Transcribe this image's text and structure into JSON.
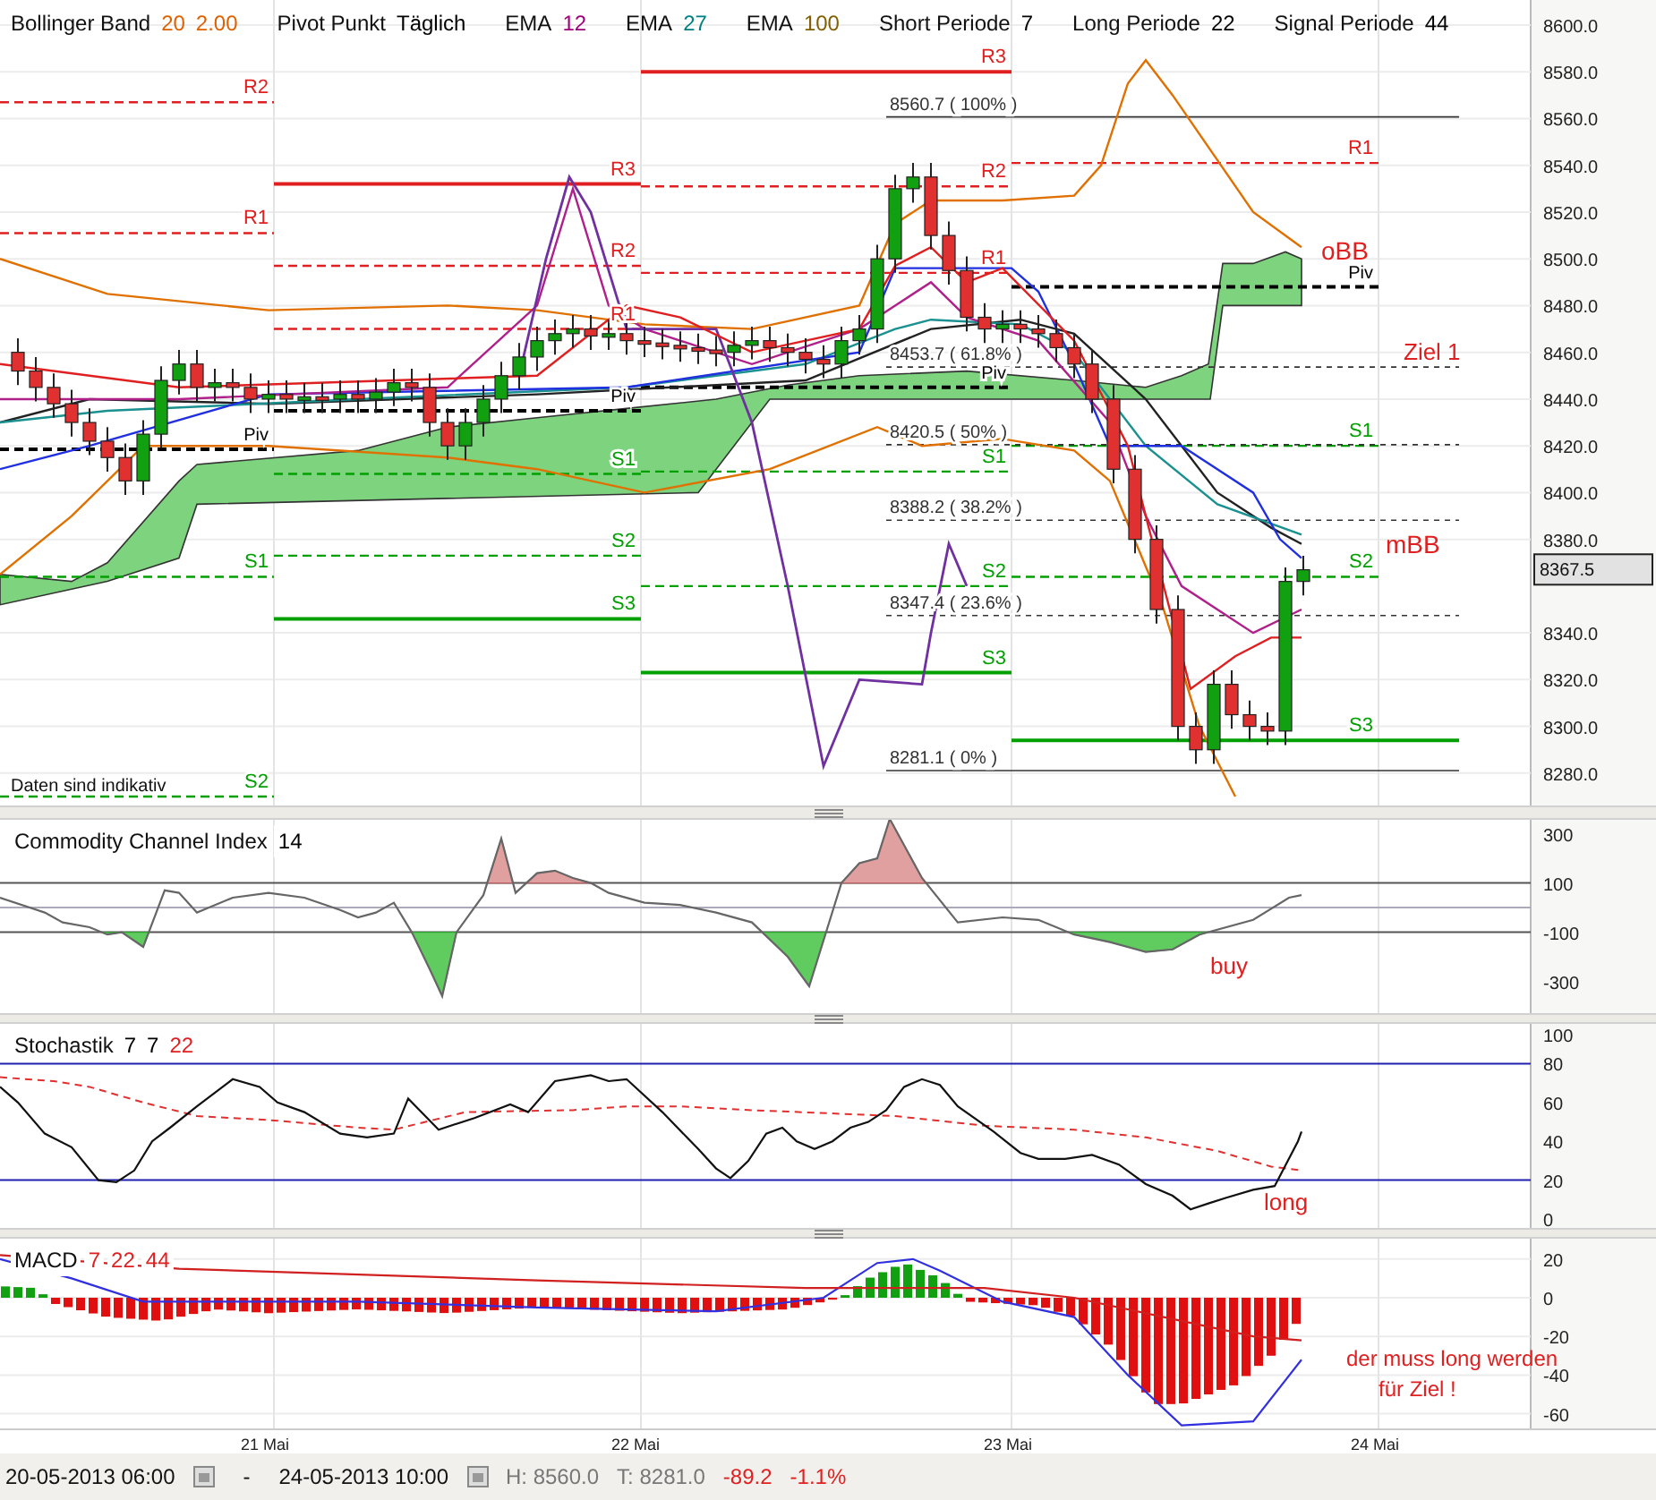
{
  "legend": [
    {
      "label": "Bollinger Band",
      "params": [
        {
          "text": "20",
          "color": "#e06000"
        },
        {
          "text": "2.00",
          "color": "#e06000"
        }
      ]
    },
    {
      "label": "Pivot Punkt",
      "params": [
        {
          "text": "Täglich",
          "color": "#000000"
        }
      ]
    },
    {
      "label": "EMA",
      "params": [
        {
          "text": "12",
          "color": "#a0007a"
        }
      ]
    },
    {
      "label": "EMA",
      "params": [
        {
          "text": "27",
          "color": "#008080"
        }
      ]
    },
    {
      "label": "EMA",
      "params": [
        {
          "text": "100",
          "color": "#806000"
        }
      ]
    },
    {
      "label": "Short Periode",
      "params": [
        {
          "text": "7",
          "color": "#000000"
        }
      ]
    },
    {
      "label": "Long Periode",
      "params": [
        {
          "text": "22",
          "color": "#000000"
        }
      ]
    },
    {
      "label": "Signal Periode",
      "params": [
        {
          "text": "44",
          "color": "#000000"
        }
      ]
    }
  ],
  "main": {
    "price_ticks": [
      "8600.0",
      "8580.0",
      "8560.0",
      "8540.0",
      "8520.0",
      "8500.0",
      "8480.0",
      "8460.0",
      "8440.0",
      "8420.0",
      "8400.0",
      "8380.0",
      "8340.0",
      "8320.0",
      "8300.0",
      "8280.0"
    ],
    "current_price": "8367.5",
    "pivot_labels": [
      {
        "text": "R2",
        "kind": "resistance"
      },
      {
        "text": "R1",
        "kind": "resistance"
      },
      {
        "text": "Piv",
        "kind": "pivot"
      },
      {
        "text": "S1",
        "kind": "support"
      },
      {
        "text": "S2",
        "kind": "support"
      },
      {
        "text": "R3",
        "kind": "resistance"
      },
      {
        "text": "R2",
        "kind": "resistance"
      },
      {
        "text": "R1",
        "kind": "resistance"
      },
      {
        "text": "Piv",
        "kind": "pivot"
      },
      {
        "text": "S1",
        "kind": "support"
      },
      {
        "text": "S2",
        "kind": "support"
      },
      {
        "text": "S3",
        "kind": "support"
      },
      {
        "text": "R3",
        "kind": "resistance"
      },
      {
        "text": "R2",
        "kind": "resistance"
      },
      {
        "text": "R1",
        "kind": "resistance"
      },
      {
        "text": "Piv",
        "kind": "pivot"
      },
      {
        "text": "S1",
        "kind": "support"
      },
      {
        "text": "S2",
        "kind": "support"
      },
      {
        "text": "S3",
        "kind": "support"
      },
      {
        "text": "R1",
        "kind": "resistance"
      },
      {
        "text": "Piv",
        "kind": "pivot"
      },
      {
        "text": "S1",
        "kind": "support"
      },
      {
        "text": "S2",
        "kind": "support"
      },
      {
        "text": "S3",
        "kind": "support"
      }
    ],
    "fib_levels": [
      "8560.7 ( 100% )",
      "8453.7 ( 61.8% )",
      "8420.5 ( 50% )",
      "8388.2 ( 38.2% )",
      "8347.4 ( 23.6% )",
      "8281.1 ( 0% )"
    ],
    "annotations": [
      {
        "text": "oBB",
        "kind": "signal"
      },
      {
        "text": "Ziel 1",
        "kind": "signal"
      },
      {
        "text": "mBB",
        "kind": "signal"
      },
      {
        "text": "Daten sind indikativ",
        "kind": "note"
      }
    ]
  },
  "cci": {
    "title": "Commodity Channel Index",
    "params": [
      {
        "text": "14",
        "color": "#000000"
      }
    ],
    "ticks": [
      "300",
      "100",
      "-100",
      "-300"
    ],
    "annotations": [
      "buy"
    ]
  },
  "stochastic": {
    "title": "Stochastik",
    "params": [
      {
        "text": "7",
        "color": "#000000"
      },
      {
        "text": "7",
        "color": "#000000"
      },
      {
        "text": "22",
        "color": "#e02020"
      }
    ],
    "ticks": [
      "100",
      "80",
      "60",
      "40",
      "20",
      "0"
    ],
    "annotations": [
      "long"
    ]
  },
  "macd": {
    "title": "MACD",
    "params": [
      {
        "text": "7",
        "color": "#e02020"
      },
      {
        "text": "22",
        "color": "#e02020"
      },
      {
        "text": "44",
        "color": "#e02020"
      }
    ],
    "ticks": [
      "20",
      "0",
      "-20",
      "-40",
      "-60"
    ],
    "annotations": [
      "der muss long werden",
      "für Ziel !"
    ]
  },
  "dates": [
    "21 Mai",
    "22 Mai",
    "23 Mai",
    "24 Mai"
  ],
  "status_bar": {
    "from": "20-05-2013 06:00",
    "separator": "-",
    "to": "24-05-2013 10:00",
    "high": "H: 8560.0",
    "low": "T: 8281.0",
    "change": "-89.2",
    "change_pct": "-1.1%"
  }
}
